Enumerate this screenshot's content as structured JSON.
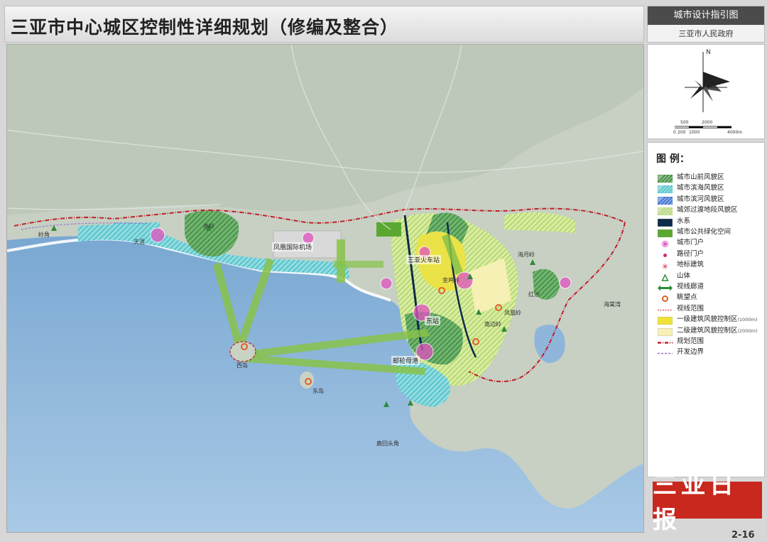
{
  "header": {
    "title": "三亚市中心城区控制性详细规划（修编及整合）",
    "sheet_name": "城市设计指引图",
    "issuer": "三亚市人民政府"
  },
  "compass": {
    "north_label": "N",
    "scale_labels": [
      "500",
      "2000",
      "0",
      "200",
      "1000",
      "4000m"
    ]
  },
  "legend": {
    "title": "图 例：",
    "items": [
      {
        "label": "城市山前风貌区",
        "swatch": "hatch-green",
        "color": "#3b8a3b"
      },
      {
        "label": "城市滨海风貌区",
        "swatch": "hatch-cyan",
        "color": "#4fc3c9"
      },
      {
        "label": "城市滨河风貌区",
        "swatch": "hatch-blue",
        "color": "#3a6fd0"
      },
      {
        "label": "城郊过渡地段风貌区",
        "swatch": "hatch-lightgreen",
        "color": "#b5d67a"
      },
      {
        "label": "水系",
        "swatch": "solid",
        "color": "#0d2a4a"
      },
      {
        "label": "城市公共绿化空间",
        "swatch": "solid",
        "color": "#5aa832"
      },
      {
        "label": "城市门户",
        "swatch": "gate",
        "color": "#e052c0"
      },
      {
        "label": "路径门户",
        "swatch": "dot",
        "color": "#d0287a"
      },
      {
        "label": "地标建筑",
        "swatch": "star",
        "color": "#d01f3a"
      },
      {
        "label": "山体",
        "swatch": "mountain",
        "color": "#2e8b3a"
      },
      {
        "label": "视线廊道",
        "swatch": "corridor",
        "color": "#2e8b3a"
      },
      {
        "label": "眺望点",
        "swatch": "viewpoint",
        "color": "#e0602a"
      },
      {
        "label": "视线范围",
        "swatch": "dashline",
        "color": "#d04040"
      },
      {
        "label": "一级建筑风貌控制区",
        "note": "(1000m)",
        "swatch": "solid",
        "color": "#f0e23a"
      },
      {
        "label": "二级建筑风貌控制区",
        "note": "(2000m)",
        "swatch": "solid",
        "color": "#f6f0b4"
      },
      {
        "label": "规划范围",
        "swatch": "boundary",
        "color": "#c0202a"
      },
      {
        "label": "开发边界",
        "swatch": "devline",
        "color": "#9a78c8"
      }
    ]
  },
  "map_labels": {
    "airport": "凤凰国际机场",
    "railway_station": "三亚火车站",
    "gate_east": "东站",
    "cruise_port": "邮轮母港",
    "island_west": "西岛",
    "island_east": "东岛",
    "place_jinji": "金鸡岭",
    "place_haiyue": "海月岭",
    "place_nanbian": "南边岭",
    "place_luhuitou": "鹿回头角",
    "place_lingjiao": "岭角",
    "place_fenghuang": "凤凰岭",
    "place_chiban": "赤岭",
    "place_hongsha": "红沙",
    "place_tianya": "天涯",
    "place_haitang": "海棠湾"
  },
  "footer": {
    "logo_text": "三亚日报",
    "page_number": "2-16"
  }
}
